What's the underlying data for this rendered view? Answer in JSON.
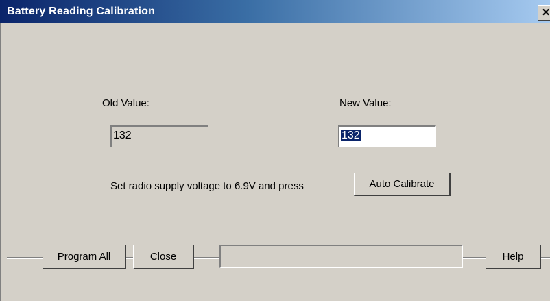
{
  "window": {
    "title": "Battery Reading Calibration",
    "close_glyph": "✕"
  },
  "calibration": {
    "old_label": "Old Value:",
    "old_value": "132",
    "new_label": "New Value:",
    "new_value": "132",
    "instruction": "Set radio supply voltage to 6.9V and press",
    "auto_calibrate_label": "Auto Calibrate"
  },
  "footer": {
    "program_all_label": "Program All",
    "close_label": "Close",
    "status_text": "",
    "help_label": "Help"
  },
  "colors": {
    "title_bar_start": "#0a246a",
    "title_bar_end": "#a6caf0",
    "window_face": "#d4d0c8",
    "selection": "#0a246a"
  }
}
